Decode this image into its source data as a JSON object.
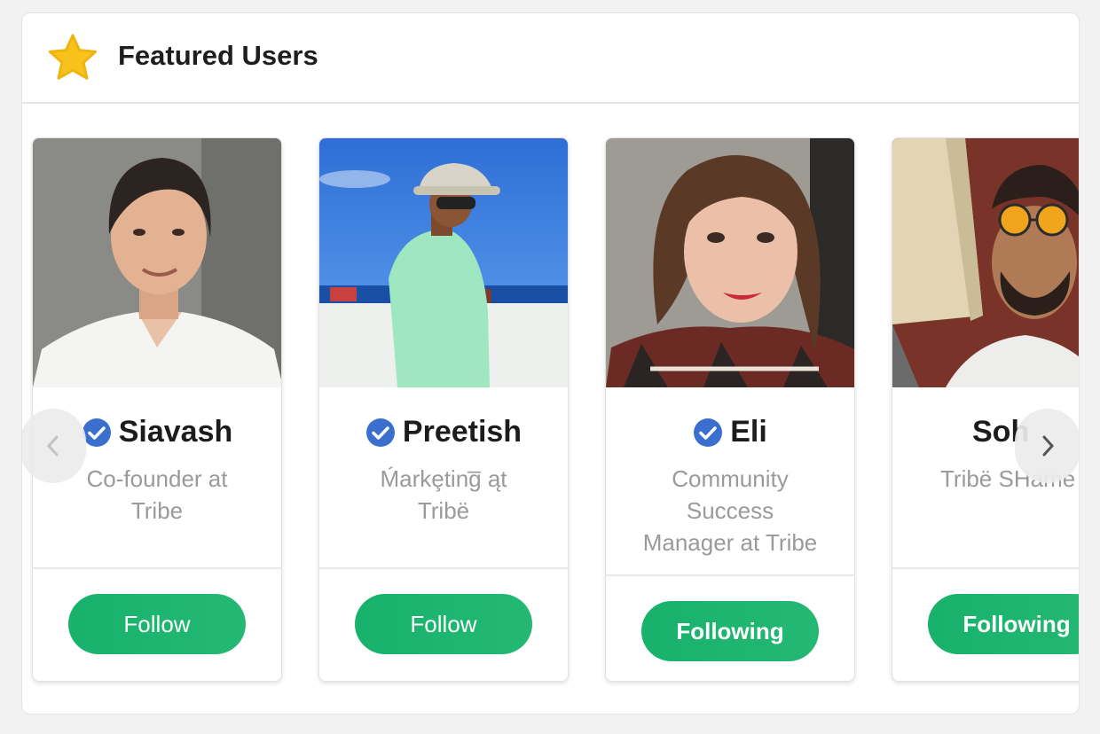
{
  "panel": {
    "title": "Featured Users",
    "icon": "star-icon",
    "accent_star": "#f7c21b",
    "button_color": "#1db46f",
    "verified_color": "#3b6fcf"
  },
  "users": [
    {
      "name": "Siavash",
      "verified": true,
      "role": "Co-founder at Tribe",
      "button": "Follow"
    },
    {
      "name": "Preetish",
      "verified": true,
      "role": "Ḿarkȩting̅ ąt Tribë",
      "button": "Follow"
    },
    {
      "name": "Eli",
      "verified": true,
      "role": "Community Success Manager at Tribe",
      "button": "Following"
    },
    {
      "name": "Soh",
      "verified": false,
      "role": "Tribë SHame",
      "button": "Following"
    }
  ],
  "nav": {
    "prev": "chevron-left-icon",
    "next": "chevron-right-icon"
  }
}
